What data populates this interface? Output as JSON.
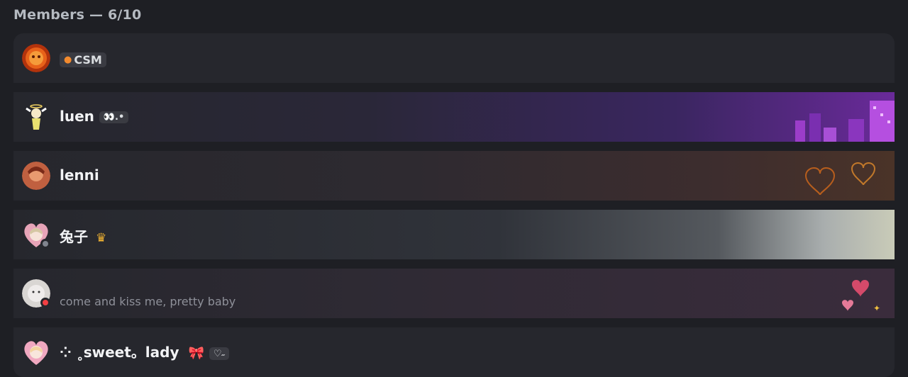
{
  "members_header": "Members — 6/10",
  "members": [
    {
      "name": "",
      "tag": "CSM",
      "tag_icon": "skull-icon",
      "status": "none"
    },
    {
      "name": "luen",
      "tag": "👀.•",
      "status": "none"
    },
    {
      "name": "lenni",
      "status": "none"
    },
    {
      "name": "兔子",
      "badge_icon": "crown-icon",
      "badge": "♛",
      "status": "offline",
      "status_color": "#80848e"
    },
    {
      "name": "",
      "custom_status": "come and kiss me, pretty baby",
      "status": "dnd",
      "status_color": "#f23f43"
    },
    {
      "name": "⁘ ˳sweet。lady",
      "emoji": "🎀",
      "tag": "♡˶",
      "status": "none"
    }
  ],
  "colors": {
    "background": "#1e1f24",
    "row": "#26272d",
    "header_text": "#b5bac1",
    "tag_bg": "#3a3b42"
  }
}
